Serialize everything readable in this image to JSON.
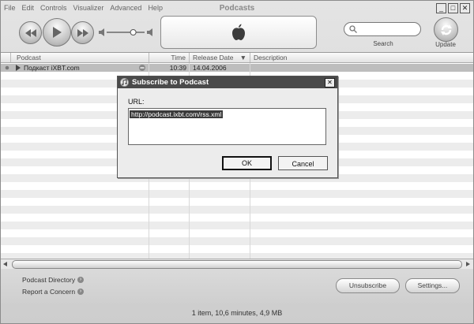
{
  "window": {
    "title": "Podcasts",
    "menu": [
      "File",
      "Edit",
      "Controls",
      "Visualizer",
      "Advanced",
      "Help"
    ],
    "controls": {
      "minimize": "_",
      "maximize": "□",
      "close": "✕"
    }
  },
  "toolbar": {
    "search_label": "Search",
    "update_label": "Update",
    "volume_level": 0.7
  },
  "table": {
    "columns": [
      "Podcast",
      "Time",
      "Release Date",
      "Description"
    ],
    "sort_indicator": "▼",
    "rows": [
      {
        "podcast": "Подкаст iXBT.com",
        "time": "10:39",
        "release_date": "14.04.2006",
        "description": ""
      }
    ]
  },
  "bottom": {
    "links": [
      "Podcast Directory",
      "Report a Concern"
    ],
    "buttons": [
      "Unsubscribe",
      "Settings..."
    ]
  },
  "status": "1 item, 10,6 minutes, 4,9 MB",
  "dialog": {
    "title": "Subscribe to Podcast",
    "url_label": "URL:",
    "url_value": "http://podcast.ixbt.com/rss.xml",
    "ok": "OK",
    "cancel": "Cancel"
  }
}
